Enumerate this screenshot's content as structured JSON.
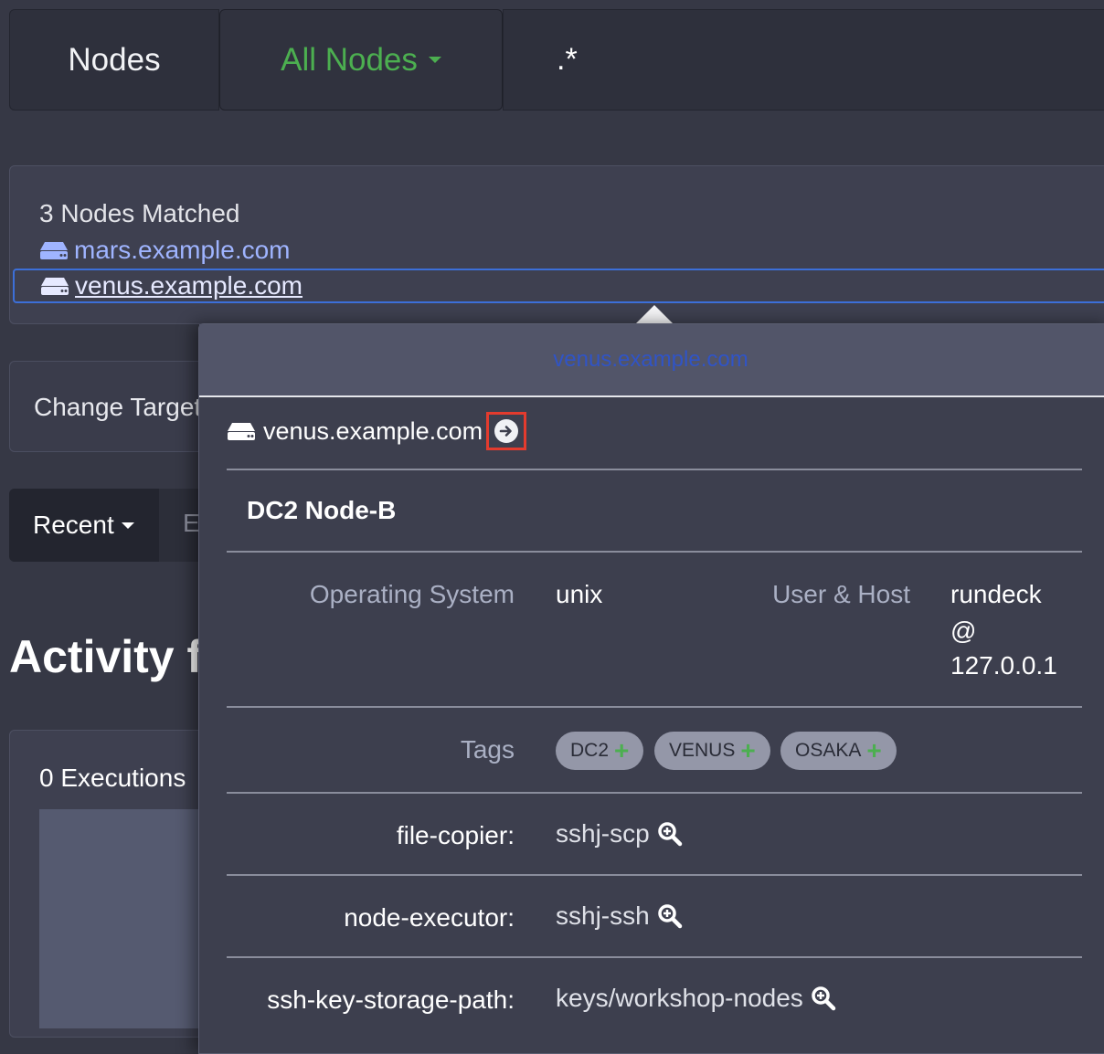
{
  "filter_bar": {
    "nodes_label": "Nodes",
    "filter_dropdown_label": "All Nodes",
    "filter_query": ".*"
  },
  "match_panel": {
    "count_label": "3 Nodes Matched",
    "nodes": [
      {
        "name": "mars.example.com"
      },
      {
        "name": "venus.example.com"
      }
    ]
  },
  "background": {
    "change_target_label": "Change Target",
    "recent_label": "Recent",
    "recent_other_label": "E",
    "activity_title": "Activity f",
    "executions_label": "0 Executions"
  },
  "popover": {
    "header_title": "venus.example.com",
    "node_name": "venus.example.com",
    "description": "DC2 Node-B",
    "os_label": "Operating System",
    "os_value": "unix",
    "user_host_label": "User & Host",
    "user_value": "rundeck",
    "at_symbol": "@",
    "host_value": "127.0.0.1",
    "tags_label": "Tags",
    "tags": [
      "DC2",
      "VENUS",
      "OSAKA"
    ],
    "attributes": [
      {
        "key": "file-copier:",
        "value": "sshj-scp"
      },
      {
        "key": "node-executor:",
        "value": "sshj-ssh"
      },
      {
        "key": "ssh-key-storage-path:",
        "value": "keys/workshop-nodes"
      }
    ]
  },
  "colors": {
    "accent_green": "#4caf50",
    "link_blue": "#9fb4ff",
    "highlight_red": "#e33b2e",
    "background": "#363845"
  },
  "icons": [
    "server-icon",
    "arrow-circle-right-icon",
    "plus-icon",
    "zoom-search-icon",
    "caret-down-icon"
  ]
}
